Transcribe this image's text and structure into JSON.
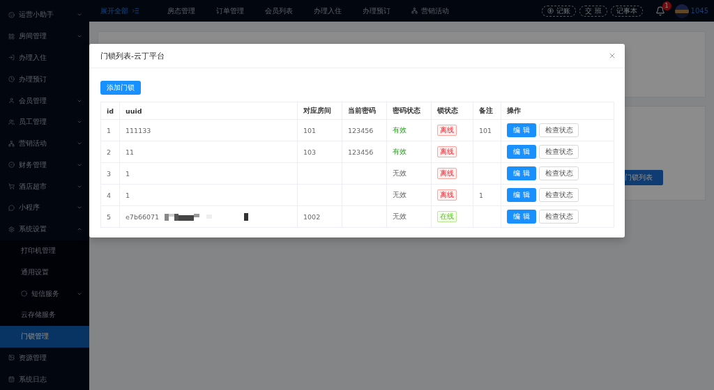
{
  "sidebar": {
    "items": [
      {
        "label": "运营小助手",
        "expanded": false,
        "selected": false
      },
      {
        "label": "房间管理",
        "expanded": false,
        "selected": false
      },
      {
        "label": "办理入住",
        "selected": false
      },
      {
        "label": "办理预订",
        "selected": false
      },
      {
        "label": "会员管理",
        "expanded": false,
        "selected": false
      },
      {
        "label": "员工管理",
        "expanded": false,
        "selected": false
      },
      {
        "label": "营销活动",
        "expanded": false,
        "selected": false
      },
      {
        "label": "财务管理",
        "expanded": false,
        "selected": false
      },
      {
        "label": "酒店超市",
        "expanded": false,
        "selected": false
      },
      {
        "label": "小程序",
        "expanded": false,
        "selected": false
      },
      {
        "label": "系统设置",
        "expanded": true,
        "selected": false,
        "children": [
          {
            "label": "打印机管理",
            "selected": false
          },
          {
            "label": "通用设置",
            "selected": false
          },
          {
            "label": "短信服务",
            "expanded": false,
            "selected": false
          },
          {
            "label": "云存储服务",
            "selected": false
          },
          {
            "label": "门锁管理",
            "selected": true
          }
        ]
      },
      {
        "label": "资源管理",
        "selected": false
      },
      {
        "label": "系统日志",
        "selected": false
      }
    ]
  },
  "topbar": {
    "expand_all": "展开全部",
    "nav": [
      {
        "label": "房态管理"
      },
      {
        "label": "订单管理"
      },
      {
        "label": "会员列表"
      },
      {
        "label": "办理入住"
      },
      {
        "label": "办理预订"
      },
      {
        "label": "营销活动"
      }
    ],
    "actions": [
      "记账",
      "交 班",
      "记事本"
    ],
    "notification_count": "1",
    "user": "1045"
  },
  "background": {
    "button": "门锁列表"
  },
  "modal": {
    "title": "门锁列表-云丁平台",
    "add_button": "添加门锁",
    "table": {
      "columns": [
        "id",
        "uuid",
        "对应房间",
        "当前密码",
        "密码状态",
        "锁状态",
        "备注",
        "操作"
      ],
      "rows": [
        {
          "id": "1",
          "uuid": "111133",
          "redacted": false,
          "room": "101",
          "password": "123456",
          "password_status": "有效",
          "password_valid": true,
          "lock_status": "离线",
          "online": false,
          "note": "101",
          "edit": "编 辑",
          "check": "检查状态"
        },
        {
          "id": "2",
          "uuid": "11",
          "redacted": false,
          "room": "103",
          "password": "123456",
          "password_status": "有效",
          "password_valid": true,
          "lock_status": "离线",
          "online": false,
          "edit": "编 辑",
          "check": "检查状态"
        },
        {
          "id": "3",
          "uuid": "1",
          "redacted": false,
          "password_status": "无效",
          "password_valid": false,
          "lock_status": "离线",
          "online": false,
          "edit": "编 辑",
          "check": "检查状态"
        },
        {
          "id": "4",
          "uuid": "1",
          "redacted": false,
          "password_status": "无效",
          "password_valid": false,
          "lock_status": "离线",
          "online": false,
          "note": "1",
          "edit": "编 辑",
          "check": "检查状态"
        },
        {
          "id": "5",
          "uuid": "e7b66071",
          "redacted": true,
          "room": "1002",
          "password_status": "无效",
          "password_valid": false,
          "lock_status": "在线",
          "online": true,
          "edit": "编 辑",
          "check": "检查状态"
        }
      ]
    }
  }
}
